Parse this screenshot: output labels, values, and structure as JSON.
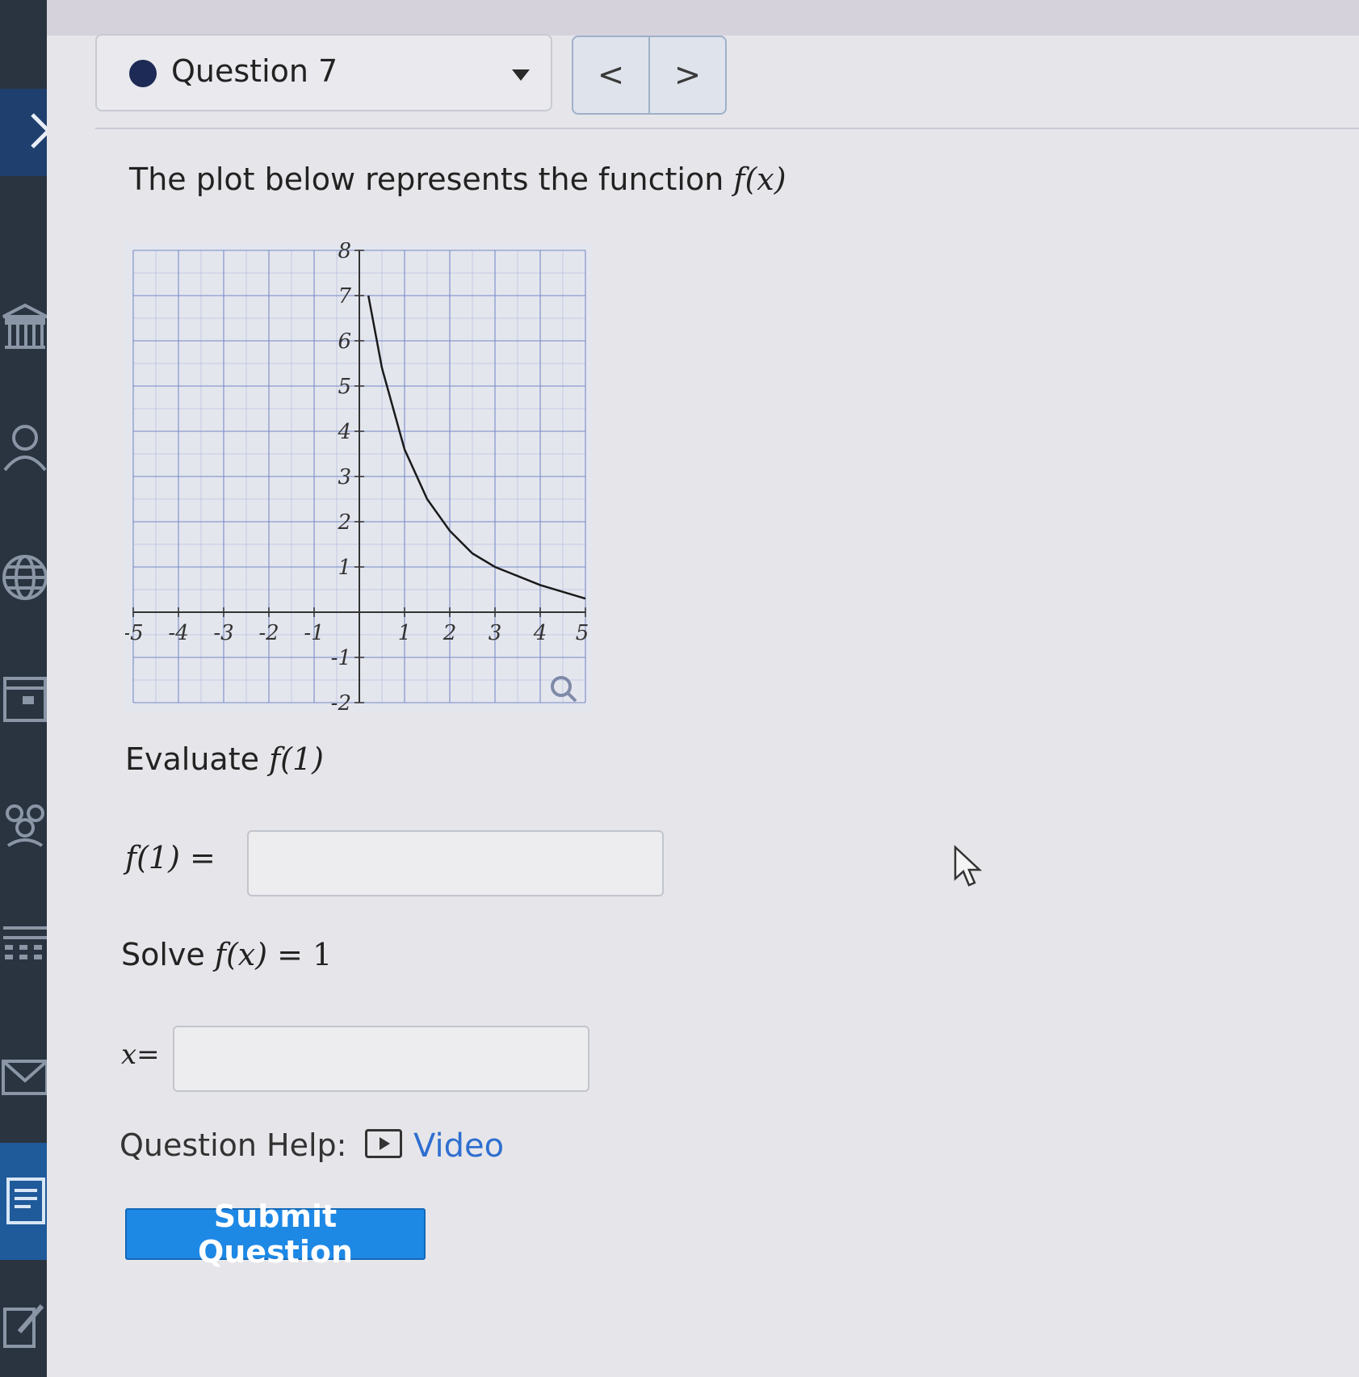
{
  "question_select": {
    "label": "Question 7"
  },
  "nav": {
    "prev_symbol": "<",
    "next_symbol": ">"
  },
  "prompt": {
    "text": "The plot below represents the function ",
    "math": "f(x)"
  },
  "chart_data": {
    "type": "line",
    "title": "",
    "xlabel": "",
    "ylabel": "",
    "xlim": [
      -5,
      5
    ],
    "ylim": [
      -2,
      8
    ],
    "grid": true,
    "x_ticks": [
      "-5",
      "-4",
      "-3",
      "-2",
      "-1",
      "1",
      "2",
      "3",
      "4",
      "5"
    ],
    "y_ticks": [
      "8",
      "7",
      "6",
      "5",
      "4",
      "3",
      "2",
      "1",
      "-1",
      "-2"
    ],
    "series": [
      {
        "x": [
          0.2,
          0.5,
          1.0,
          1.5,
          2.0,
          2.5,
          3.0,
          3.5,
          4.0,
          4.5,
          5.0
        ],
        "y": [
          7.0,
          5.4,
          3.6,
          2.5,
          1.8,
          1.3,
          1.0,
          0.8,
          0.6,
          0.45,
          0.3
        ]
      }
    ]
  },
  "q1": {
    "evaluate_text": "Evaluate ",
    "evaluate_math": "f(1)",
    "answer_label": "f(1) =",
    "answer_value": ""
  },
  "q2": {
    "solve_text": "Solve ",
    "solve_math": "f(x)",
    "solve_rhs": " = 1",
    "answer_label": "x=",
    "answer_value": ""
  },
  "help": {
    "label": "Question Help:",
    "video_link": "Video"
  },
  "submit": {
    "label": "Submit Question"
  },
  "colors": {
    "sidebar": "#2a3440",
    "accent": "#1e88e5",
    "link": "#2f6fd0",
    "grid": "#7b8fc9"
  }
}
